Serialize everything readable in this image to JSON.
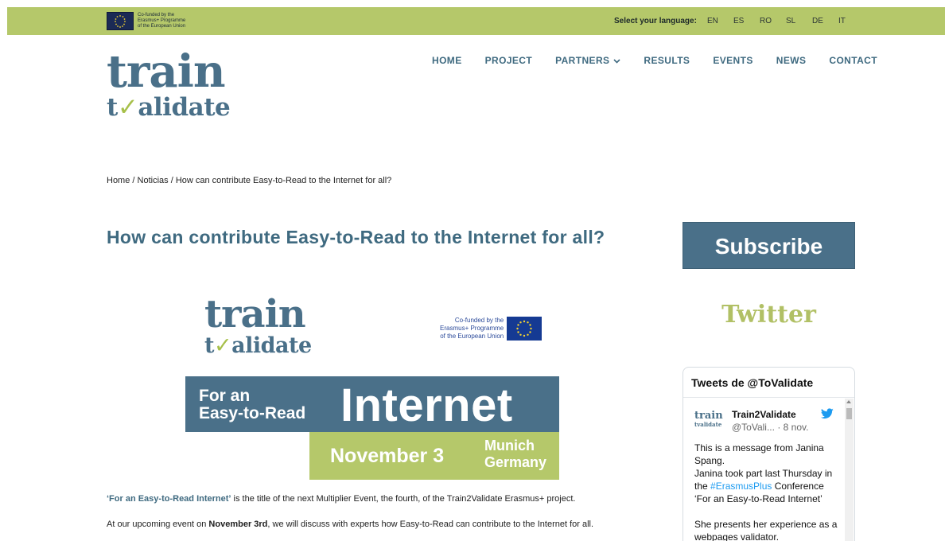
{
  "topbar": {
    "eu_line1": "Co-funded by the",
    "eu_line2": "Erasmus+ Programme",
    "eu_line3": "of the European Union",
    "lang_label": "Select your language:",
    "languages": [
      "EN",
      "ES",
      "RO",
      "SL",
      "DE",
      "IT"
    ]
  },
  "logo": {
    "word1": "train",
    "word2_a": "t",
    "word2_check": "✓",
    "word2_b": "alidate"
  },
  "nav": {
    "items": [
      "HOME",
      "PROJECT",
      "PARTNERS",
      "RESULTS",
      "EVENTS",
      "NEWS",
      "CONTACT"
    ],
    "dropdown_icon": "chevron-down-icon"
  },
  "breadcrumb": {
    "home": "Home",
    "sep": " / ",
    "section": "Noticias",
    "current": "How can contribute Easy-to-Read to the Internet for all?"
  },
  "article": {
    "title": "How can contribute Easy-to-Read to the Internet for all?",
    "banner": {
      "eu_line1": "Co-funded by the",
      "eu_line2": "Erasmus+ Programme",
      "eu_line3": "of the European Union",
      "for_an": "For an",
      "easy": "Easy-to-Read",
      "internet": "Internet",
      "date": "November 3",
      "city": "Munich",
      "country": "Germany"
    },
    "p1_link": "‘For an Easy-to-Read Internet’",
    "p1_rest": " is the title of the next Multiplier Event, the fourth, of  the Train2Validate Erasmus+ project.",
    "p2_a": "At our upcoming event on ",
    "p2_bold": "November 3rd",
    "p2_b": ", we will discuss with experts how Easy-to-Read can contribute to the Internet for all."
  },
  "sidebar": {
    "subscribe": "Subscribe",
    "twitter_heading": "Twitter",
    "tweets_title": "Tweets de @ToValidate",
    "tweet": {
      "avatar_line1": "train",
      "avatar_line2": "tvalidate",
      "name": "Train2Validate",
      "handle": "@ToVali...",
      "date": " · 8 nov.",
      "line1": "This is a message from Janina Spang.",
      "line2": "Janina took part last Thursday in the ",
      "hashtag": "#ErasmusPlus",
      "line3": " Conference ‘For an Easy-to-Read Internet’",
      "line4": "She presents her experience as a webpages validator."
    }
  },
  "colors": {
    "accent_green": "#b5c86a",
    "brand_blue": "#4a7089",
    "twitter_blue": "#1d9bf0"
  }
}
